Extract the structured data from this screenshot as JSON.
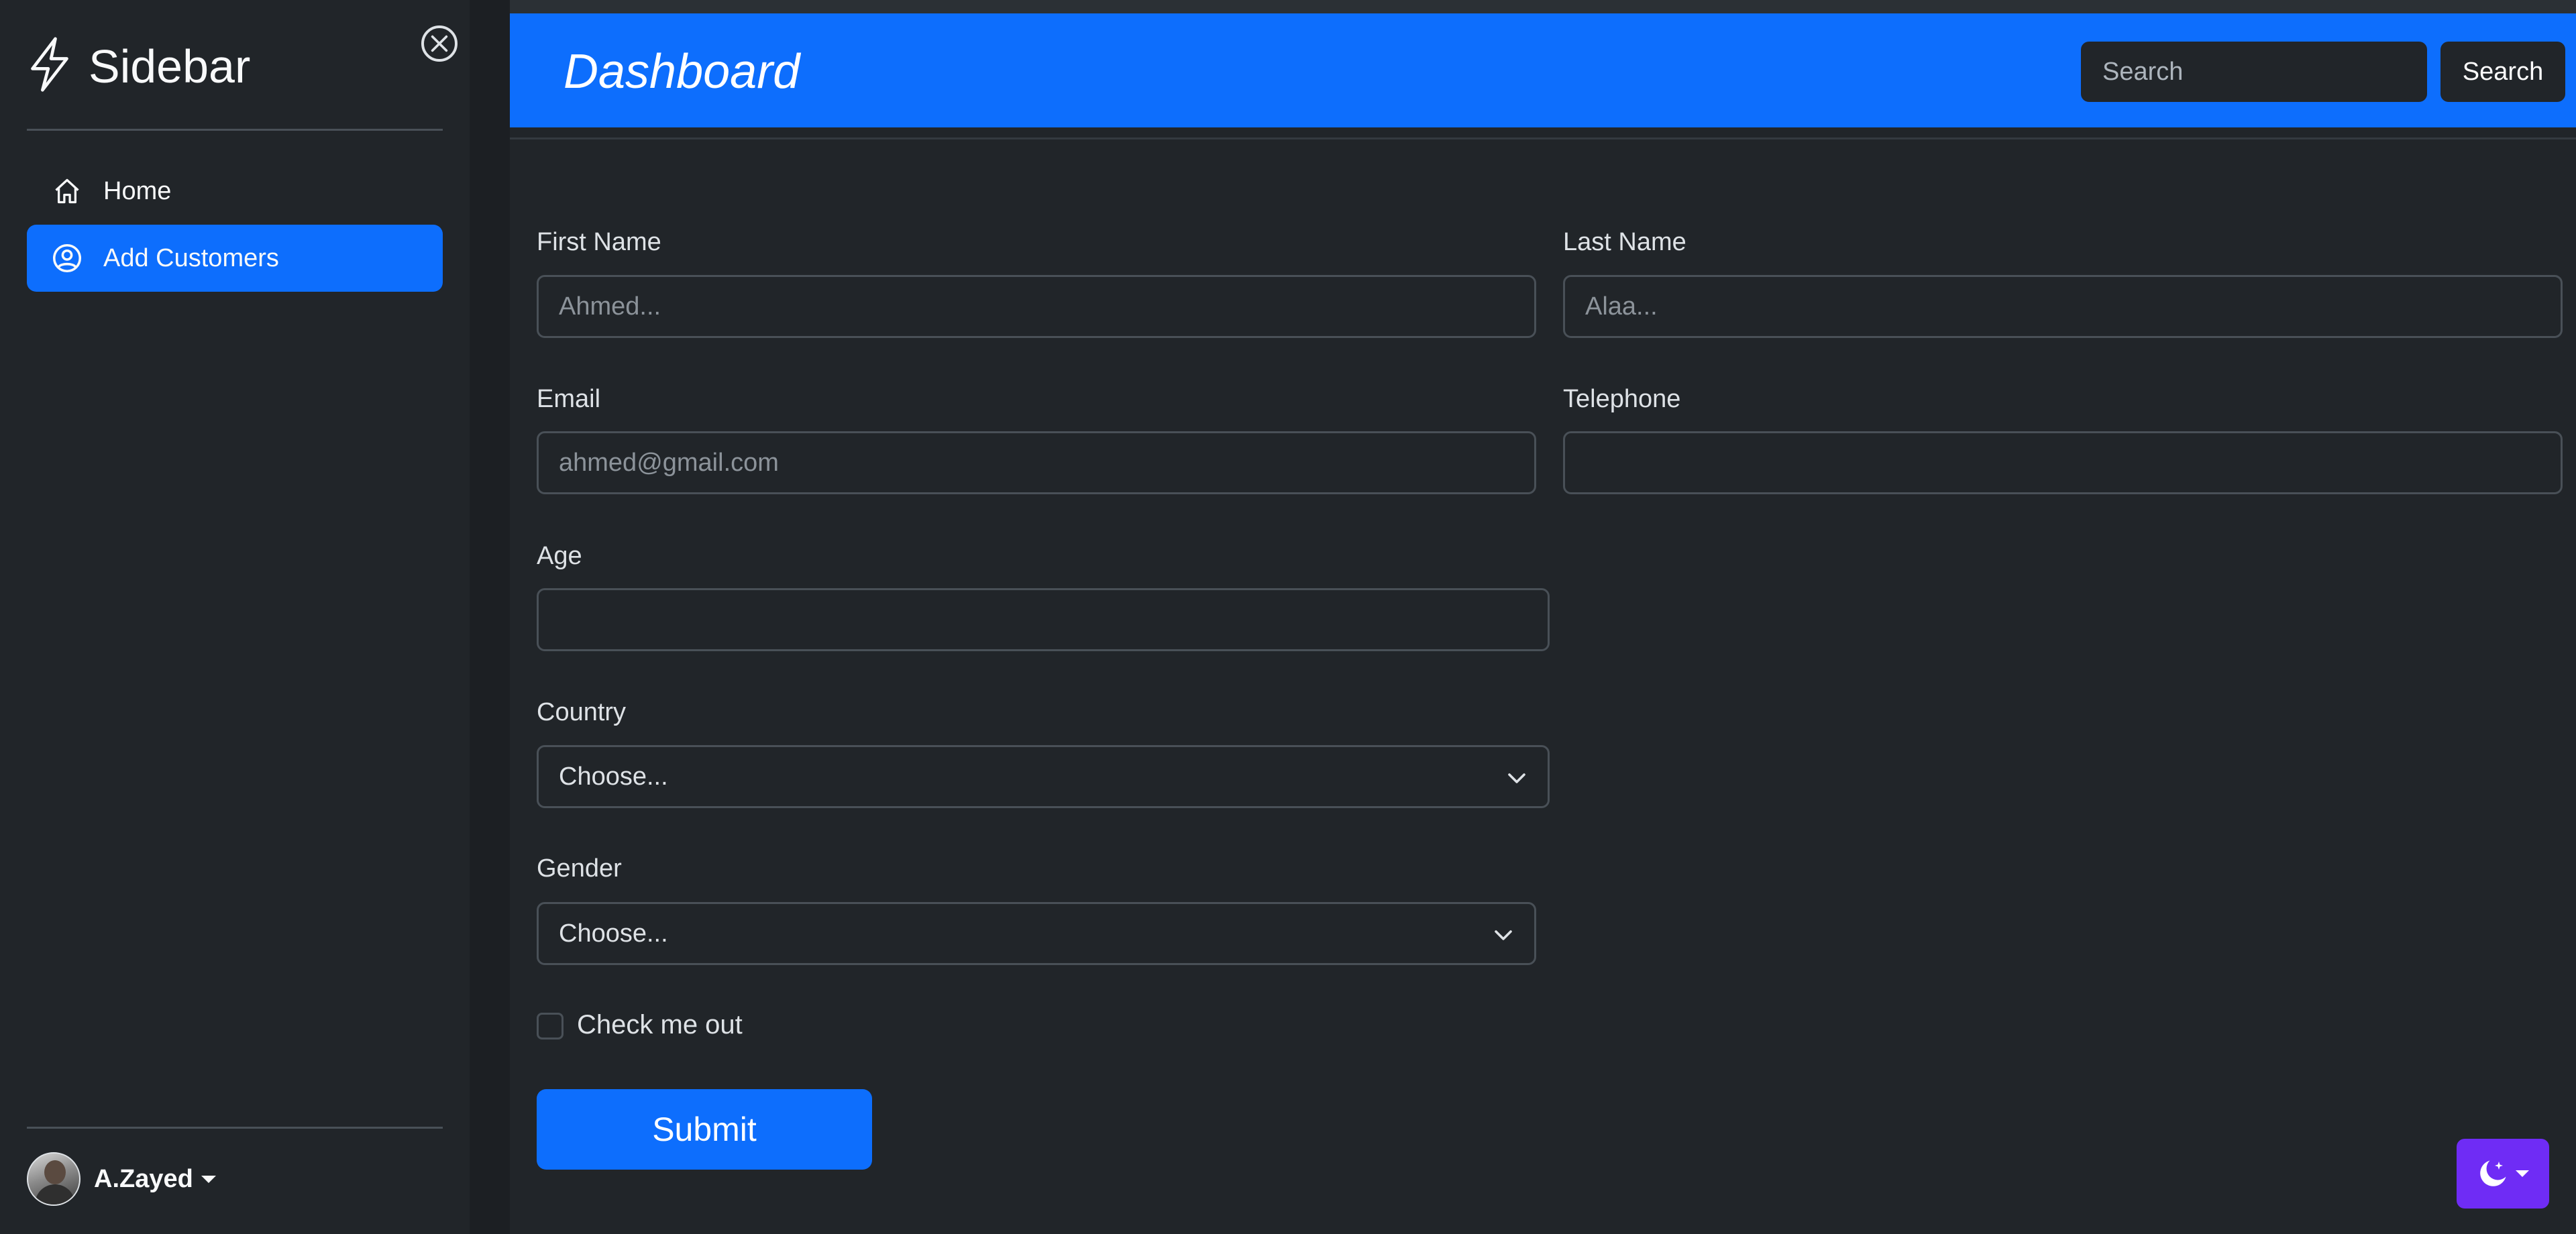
{
  "sidebar": {
    "brand_title": "Sidebar",
    "nav": [
      {
        "label": "Home",
        "icon": "house-icon",
        "active": false
      },
      {
        "label": "Add Customers",
        "icon": "person-circle-icon",
        "active": true
      }
    ],
    "user": {
      "name": "A.Zayed"
    }
  },
  "header": {
    "title": "Dashboard",
    "search_placeholder": "Search",
    "search_button": "Search"
  },
  "form": {
    "first_name": {
      "label": "First Name",
      "placeholder": "Ahmed..."
    },
    "last_name": {
      "label": "Last Name",
      "placeholder": "Alaa..."
    },
    "email": {
      "label": "Email",
      "placeholder": "ahmed@gmail.com"
    },
    "telephone": {
      "label": "Telephone",
      "placeholder": ""
    },
    "age": {
      "label": "Age",
      "placeholder": ""
    },
    "country": {
      "label": "Country",
      "selected": "Choose..."
    },
    "gender": {
      "label": "Gender",
      "selected": "Choose..."
    },
    "checkbox_label": "Check me out",
    "submit_label": "Submit"
  },
  "colors": {
    "primary": "#0d6efd",
    "background": "#212529",
    "theme_toggle": "#6f2cf5"
  }
}
